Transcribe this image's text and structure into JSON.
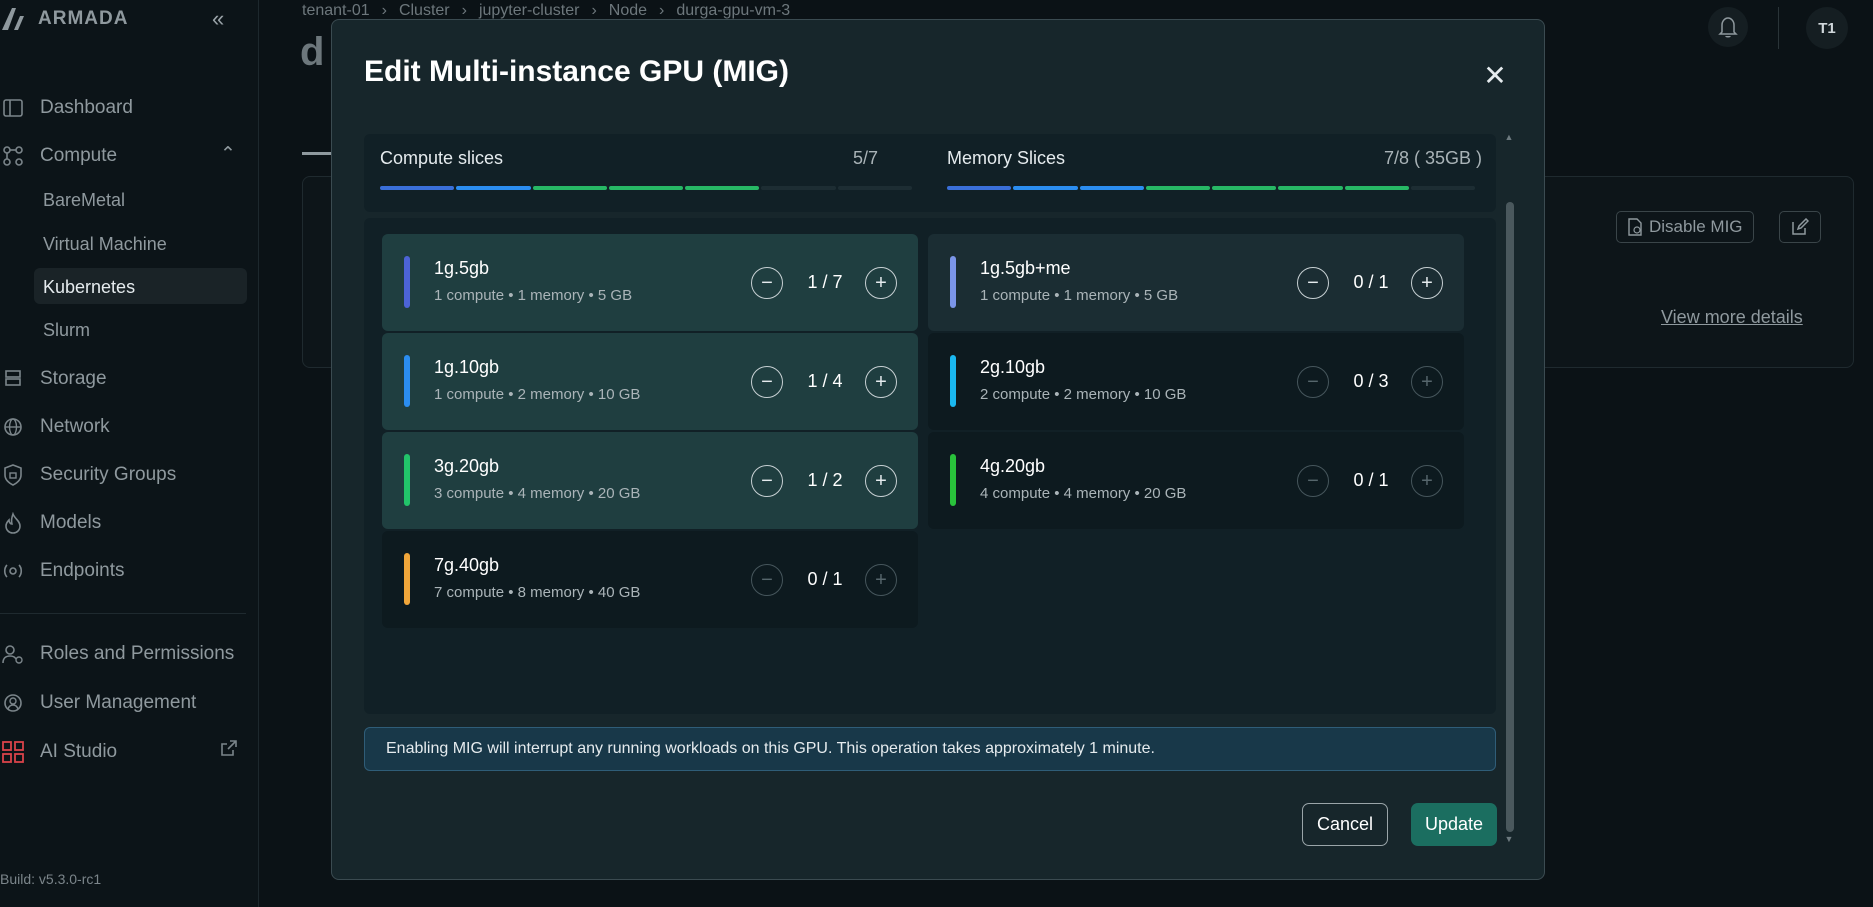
{
  "app": {
    "brand": "ARMADA",
    "build": "Build: v5.3.0-rc1"
  },
  "sidebar": {
    "collapse_label": "«",
    "items": [
      {
        "label": "Dashboard",
        "icon": "dashboard-icon"
      },
      {
        "label": "Compute",
        "icon": "compute-icon"
      },
      {
        "label": "Storage",
        "icon": "storage-icon"
      },
      {
        "label": "Network",
        "icon": "network-icon"
      },
      {
        "label": "Security Groups",
        "icon": "security-icon"
      },
      {
        "label": "Models",
        "icon": "models-icon"
      },
      {
        "label": "Endpoints",
        "icon": "endpoints-icon"
      },
      {
        "label": "Roles and Permissions",
        "icon": "roles-icon"
      },
      {
        "label": "User Management",
        "icon": "user-management-icon"
      },
      {
        "label": "AI Studio",
        "icon": "ai-studio-icon"
      }
    ],
    "compute_sub": [
      "BareMetal",
      "Virtual Machine",
      "Kubernetes",
      "Slurm"
    ],
    "active_sub": "Kubernetes"
  },
  "header": {
    "breadcrumb": [
      "tenant-01",
      "Cluster",
      "jupyter-cluster",
      "Node",
      "durga-gpu-vm-3"
    ],
    "page_title_partial": "d",
    "avatar": "T1"
  },
  "background": {
    "disable_mig_label": "Disable MIG",
    "view_more_label": "View more details"
  },
  "modal": {
    "title": "Edit Multi-instance GPU (MIG)",
    "compute_slices": {
      "label": "Compute slices",
      "count": "5/7",
      "used": 5,
      "total": 7
    },
    "memory_slices": {
      "label": "Memory Slices",
      "count": "7/8 ( 35GB )",
      "used": 7,
      "total": 8
    },
    "profiles": [
      {
        "name": "1g.5gb",
        "desc": "1 compute • 1 memory • 5 GB",
        "value": "1 / 7",
        "color": "#4c63d6",
        "state": "active"
      },
      {
        "name": "1g.5gb+me",
        "desc": "1 compute • 1 memory • 5 GB",
        "value": "0 / 1",
        "color": "#7b95e8",
        "state": "hi"
      },
      {
        "name": "1g.10gb",
        "desc": "1 compute • 2 memory • 10 GB",
        "value": "1 / 4",
        "color": "#2b8df0",
        "state": "active"
      },
      {
        "name": "2g.10gb",
        "desc": "2 compute • 2 memory • 10 GB",
        "value": "0 / 3",
        "color": "#1ab8f0",
        "state": "dim"
      },
      {
        "name": "3g.20gb",
        "desc": "3 compute • 4 memory • 20 GB",
        "value": "1 / 2",
        "color": "#22c46a",
        "state": "active"
      },
      {
        "name": "4g.20gb",
        "desc": "4 compute • 4 memory • 20 GB",
        "value": "0 / 1",
        "color": "#29c23b",
        "state": "dim"
      },
      {
        "name": "7g.40gb",
        "desc": "7 compute • 8 memory • 40 GB",
        "value": "0 / 1",
        "color": "#f0a63a",
        "state": "dim"
      }
    ],
    "notice": "Enabling MIG will interrupt any running workloads on this GPU. This operation takes approximately 1 minute.",
    "cancel_label": "Cancel",
    "update_label": "Update",
    "close_label": "✕"
  },
  "colors": {
    "accent": "#1b6e60",
    "segment_blue": "#3a6fd8",
    "segment_blue2": "#2b8df0",
    "segment_green": "#27b865"
  }
}
